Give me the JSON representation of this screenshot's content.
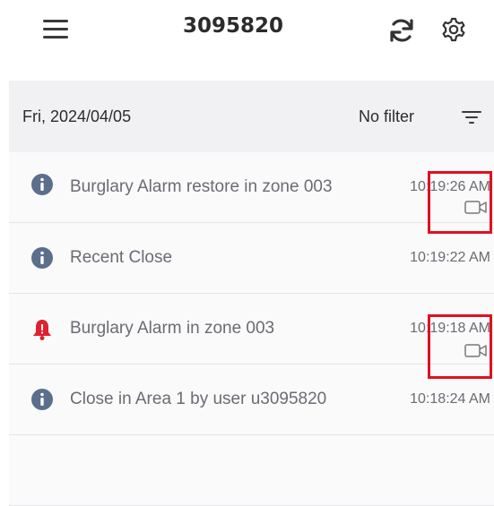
{
  "header": {
    "title": "3095820",
    "menu_icon": "hamburger-menu-icon",
    "refresh_icon": "refresh-icon",
    "settings_icon": "gear-icon"
  },
  "list_header": {
    "date": "Fri, 2024/04/05",
    "filter_label": "No filter",
    "filter_icon": "filter-icon"
  },
  "events": [
    {
      "icon": "info-icon",
      "message": "Burglary Alarm restore in zone 003",
      "time": "10:19:26 AM",
      "has_video": true,
      "highlighted": true
    },
    {
      "icon": "info-icon",
      "message": "Recent Close",
      "time": "10:19:22 AM",
      "has_video": false,
      "highlighted": false
    },
    {
      "icon": "alarm-bell-icon",
      "message": "Burglary Alarm in zone 003",
      "time": "10:19:18 AM",
      "has_video": true,
      "highlighted": true
    },
    {
      "icon": "info-icon",
      "message": "Close in Area 1 by user u3095820",
      "time": "10:18:24 AM",
      "has_video": false,
      "highlighted": false
    }
  ],
  "colors": {
    "info_icon": "#5b6f8c",
    "alarm_icon": "#e0202e",
    "highlight_box": "#e01020",
    "text": "#6b6b73"
  }
}
